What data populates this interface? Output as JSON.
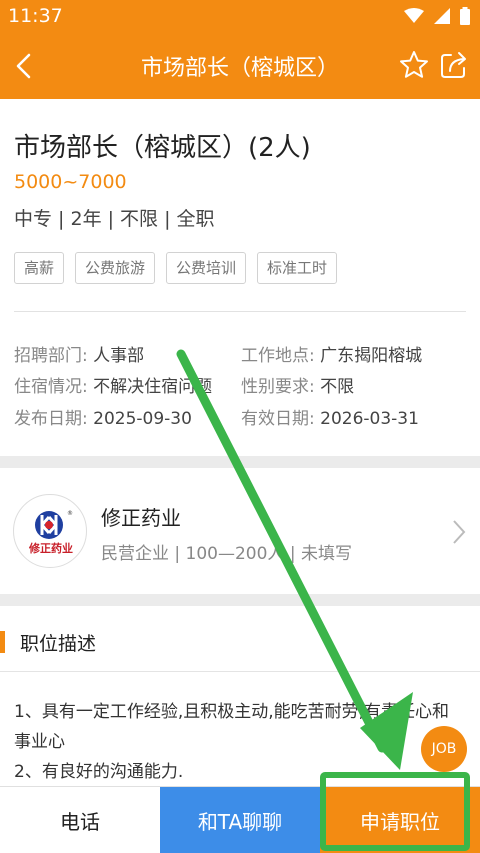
{
  "status_bar": {
    "time": "11:37"
  },
  "app_bar": {
    "title": "市场部长（榕城区）",
    "back_icon": "chevron-left-icon",
    "favorite_icon": "star-icon",
    "share_icon": "share-icon"
  },
  "job": {
    "title": "市场部长（榕城区）(2人)",
    "salary": "5000~7000",
    "requirements": "中专 | 2年 | 不限 | 全职",
    "tags": [
      "高薪",
      "公费旅游",
      "公费培训",
      "标准工时"
    ]
  },
  "details": {
    "department_label": "招聘部门:",
    "department_value": "人事部",
    "location_label": "工作地点:",
    "location_value": "广东揭阳榕城",
    "housing_label": "住宿情况:",
    "housing_value": "不解决住宿问题",
    "gender_label": "性别要求:",
    "gender_value": "不限",
    "publish_label": "发布日期:",
    "publish_value": "2025-09-30",
    "valid_label": "有效日期:",
    "valid_value": "2026-03-31"
  },
  "company": {
    "name": "修正药业",
    "meta": "民营企业 | 100—200人 | 未填写",
    "logo_text": "修正药业",
    "logo_mark": "®"
  },
  "description": {
    "section_title": "职位描述",
    "lines": [
      "1、具有一定工作经验,且积极主动,能吃苦耐劳,有责任心和事业心",
      "2、有良好的沟通能力."
    ]
  },
  "fab": {
    "label": "JOB"
  },
  "bottom_bar": {
    "phone_label": "电话",
    "chat_label": "和TA聊聊",
    "apply_label": "申请职位"
  },
  "colors": {
    "brand_orange": "#f38b12",
    "chat_blue": "#3d8de8",
    "annotation_green": "#3bb54a"
  }
}
